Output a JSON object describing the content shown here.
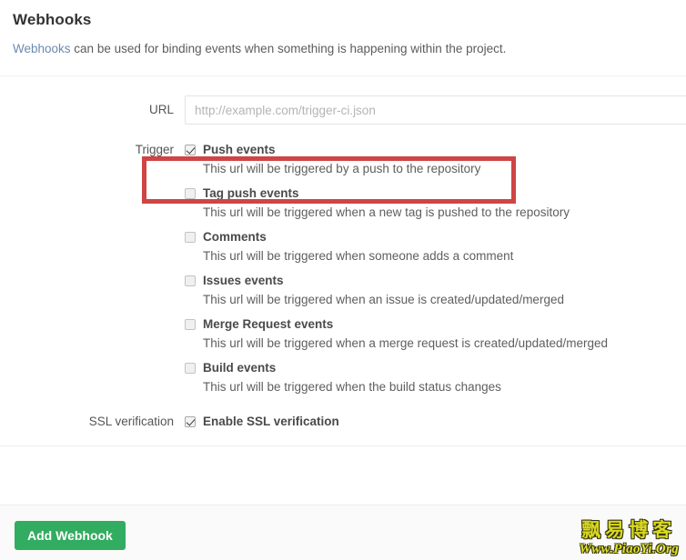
{
  "header": {
    "title": "Webhooks",
    "intro_link": "Webhooks",
    "intro_rest": " can be used for binding events when something is happening within the project."
  },
  "form": {
    "url": {
      "label": "URL",
      "placeholder": "http://example.com/trigger-ci.json",
      "value": ""
    },
    "trigger": {
      "label": "Trigger",
      "items": [
        {
          "label": "Push events",
          "description": "This url will be triggered by a push to the repository",
          "checked": true
        },
        {
          "label": "Tag push events",
          "description": "This url will be triggered when a new tag is pushed to the repository",
          "checked": false
        },
        {
          "label": "Comments",
          "description": "This url will be triggered when someone adds a comment",
          "checked": false
        },
        {
          "label": "Issues events",
          "description": "This url will be triggered when an issue is created/updated/merged",
          "checked": false
        },
        {
          "label": "Merge Request events",
          "description": "This url will be triggered when a merge request is created/updated/merged",
          "checked": false
        },
        {
          "label": "Build events",
          "description": "This url will be triggered when the build status changes",
          "checked": false
        }
      ]
    },
    "ssl": {
      "label": "SSL verification",
      "checkbox_label": "Enable SSL verification",
      "checked": true
    }
  },
  "footer": {
    "submit_label": "Add Webhook"
  },
  "watermark": {
    "cn": "飘易博客",
    "en": "Www.PiaoYi.Org"
  },
  "colors": {
    "accent_green": "#31ac60",
    "annotation_red": "#cf4444",
    "link_blue": "#6b8ab0",
    "watermark_yellow": "#d8d820"
  }
}
